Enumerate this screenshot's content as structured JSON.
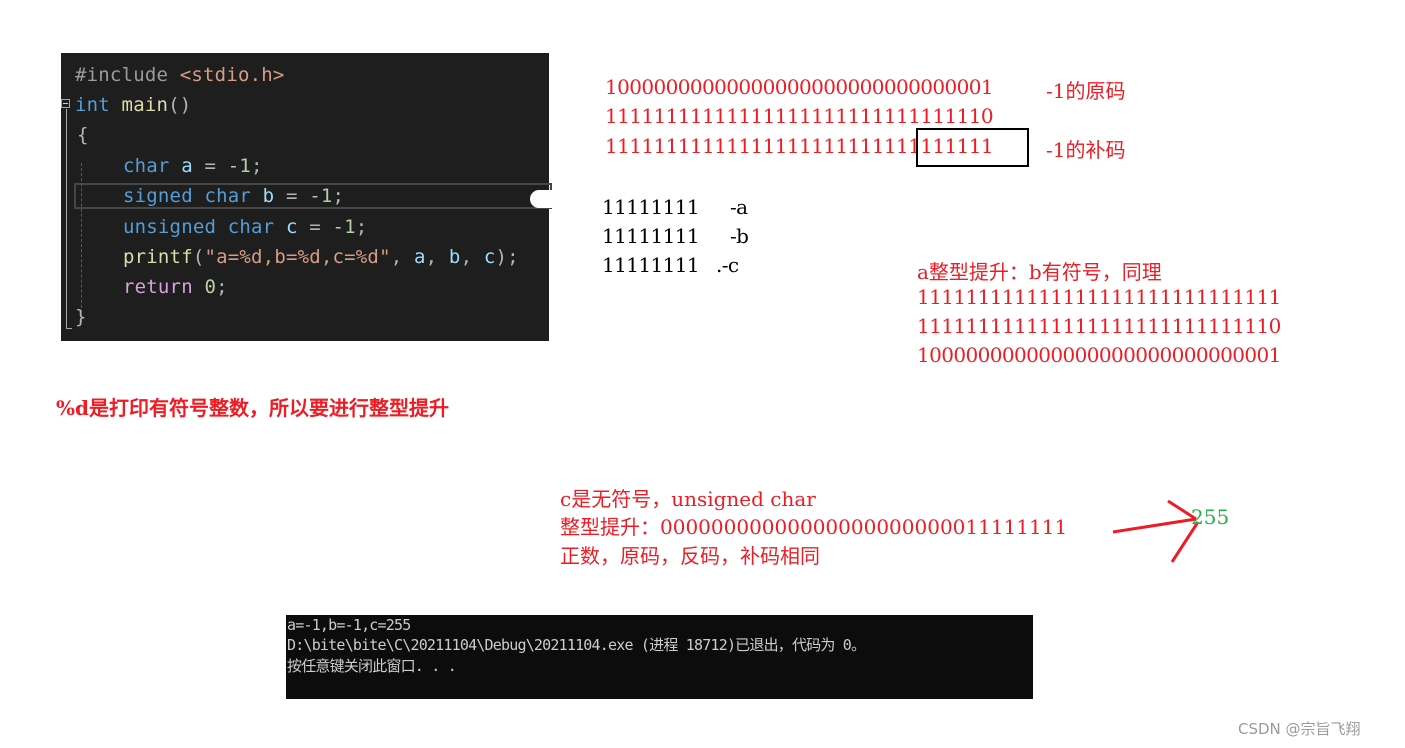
{
  "editor": {
    "lines": {
      "l1": {
        "hash": "#include",
        "path": " <stdio.h>"
      },
      "l2": {
        "kw": "int",
        "fn": " main",
        "rest": "()"
      },
      "l3": {
        "text": "{"
      },
      "l4": {
        "kw": "char",
        "var": " a",
        "rest": " = ",
        "num": "-1",
        "end": ";"
      },
      "l5": {
        "kw": "signed char",
        "var": " b",
        "rest": " = ",
        "num": "-1",
        "end": ";"
      },
      "l6": {
        "kw": "unsigned char",
        "var": " c",
        "rest": " = ",
        "num": "-1",
        "end": ";"
      },
      "l7": {
        "fn": "printf",
        "open": "(",
        "str": "\"a=%d,b=%d,c=%d\"",
        "comma1": ", ",
        "a": "a",
        "comma2": ", ",
        "b": "b",
        "comma3": ", ",
        "c": "c",
        "end": ");"
      },
      "l8": {
        "kw": "return",
        "num": " 0",
        "end": ";"
      },
      "l9": {
        "text": "}"
      }
    }
  },
  "notes": {
    "original_code_label": "-1的原码",
    "complement_label": "-1的补码",
    "bits_original": "10000000000000000000000000000001",
    "bits_ones": "11111111111111111111111111111110",
    "bits_twos": "11111111111111111111111111111111",
    "truncated": [
      {
        "bits": "11111111",
        "label": "-a"
      },
      {
        "bits": "11111111",
        "label": "-b"
      },
      {
        "bits": "11111111",
        "label": ".-c"
      }
    ],
    "promotion_title": "a整型提升：b有符号，同理",
    "promotion_lines": [
      "111111111111111111111111111111",
      "111111111111111111111111111110",
      "100000000000000000000000000001"
    ],
    "printf_note": "%d是打印有符号整数，所以要进行整型提升",
    "c_title": "c是无符号，unsigned char",
    "c_promo": "整型提升：00000000000000000000000011111111",
    "c_note": "正数，原码，反码，补码相同",
    "result_value": "255"
  },
  "console": {
    "line1": "a=-1,b=-1,c=255",
    "line2": "D:\\bite\\bite\\C\\20211104\\Debug\\20211104.exe (进程 18712)已退出，代码为 0。",
    "line3": "按任意键关闭此窗口. . ."
  },
  "watermark": "CSDN @宗旨飞翔",
  "colors": {
    "annotation_red": "#ee1c24",
    "result_green": "#22b14c",
    "editor_bg": "#1e1e1e",
    "console_bg": "#0c0c0c"
  }
}
